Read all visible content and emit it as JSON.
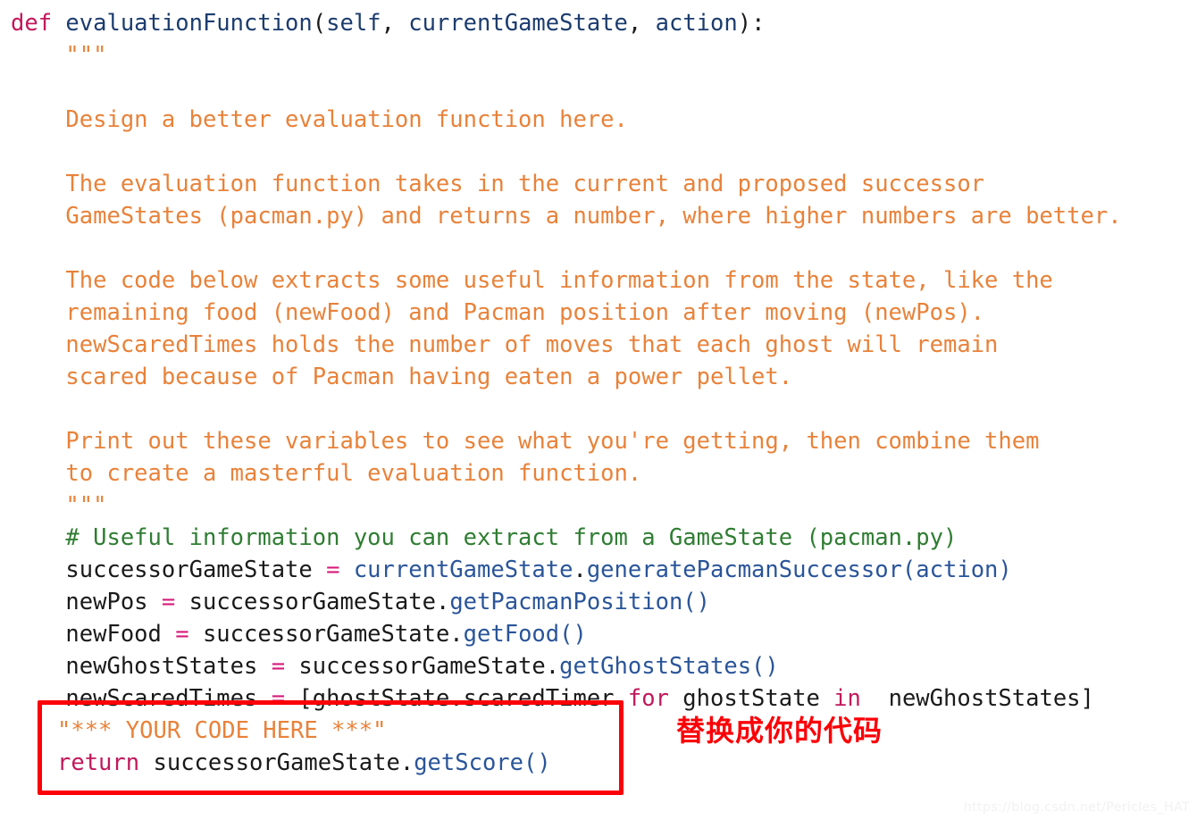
{
  "editor": {
    "language": "python",
    "background_color": "#ffffff",
    "syntax_colors": {
      "keyword": "#c2185b",
      "function_name": "#1c3c6e",
      "parameter": "#1c3c6e",
      "variable": "#1a1a1a",
      "operator": "#d81b7a",
      "method": "#2a5599",
      "docstring": "#e8823a",
      "comment": "#2f7d32",
      "punctuation": "#1a1a1a"
    }
  },
  "signature": {
    "keyword_def": "def",
    "function_name": "evaluationFunction",
    "open_paren": "(",
    "param_self": "self",
    "comma1": ", ",
    "param_current_game_state": "currentGameState",
    "comma2": ", ",
    "param_action": "action",
    "close_paren_colon": "):"
  },
  "docstring": {
    "open_quotes": "\"\"\"",
    "close_quotes": "\"\"\"",
    "lines": [
      "Design a better evaluation function here.",
      "The evaluation function takes in the current and proposed successor",
      "GameStates (pacman.py) and returns a number, where higher numbers are better.",
      "The code below extracts some useful information from the state, like the",
      "remaining food (newFood) and Pacman position after moving (newPos).",
      "newScaredTimes holds the number of moves that each ghost will remain",
      "scared because of Pacman having eaten a power pellet.",
      "Print out these variables to see what you're getting, then combine them",
      "to create a masterful evaluation function."
    ]
  },
  "comment_line": "# Useful information you can extract from a GameState (pacman.py)",
  "code_lines": [
    {
      "var": "successorGameState",
      "op": " = ",
      "object": "currentGameState",
      "dot": ".",
      "method": "generatePacmanSuccessor(action)"
    },
    {
      "var": "newPos",
      "op": " = ",
      "object": "successorGameState",
      "dot": ".",
      "method": "getPacmanPosition()"
    },
    {
      "var": "newFood",
      "op": " = ",
      "object": "successorGameState",
      "dot": ".",
      "method": "getFood()"
    },
    {
      "var": "newGhostStates",
      "op": " = ",
      "object": "successorGameState",
      "dot": ".",
      "method": "getGhostStates()"
    }
  ],
  "scared_times_line": {
    "var": "newScaredTimes",
    "op": " = ",
    "bracket_open": "[ghostState.scaredTimer",
    "kw_for": " for ",
    "loop_var": "ghostState",
    "kw_in": " in ",
    "iterable_close": " newGhostStates]"
  },
  "highlighted_block": {
    "border_color": "#fb0007",
    "placeholder_string": "\"*** YOUR CODE HERE ***\"",
    "return_keyword": "return",
    "return_object": "successorGameState",
    "return_dot": ".",
    "return_method": "getScore()"
  },
  "annotation": {
    "text": "替换成你的代码",
    "color": "#fb0007"
  },
  "watermark": {
    "text": "https://blog.csdn.net/Pericles_HAT"
  }
}
